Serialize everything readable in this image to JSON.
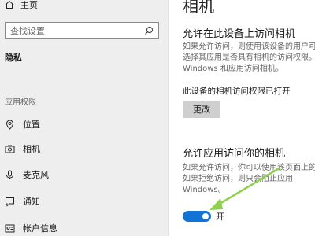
{
  "sidebar": {
    "home_label": "主页",
    "search_placeholder": "查找设置",
    "privacy_label": "隐私",
    "section_label": "应用权限",
    "items": [
      {
        "label": "位置",
        "icon": "location-icon"
      },
      {
        "label": "相机",
        "icon": "camera-icon"
      },
      {
        "label": "麦克风",
        "icon": "microphone-icon"
      },
      {
        "label": "通知",
        "icon": "notification-icon"
      },
      {
        "label": "帐户信息",
        "icon": "account-info-icon"
      }
    ]
  },
  "main": {
    "title": "相机",
    "device_access": {
      "heading": "允许在此设备上访问相机",
      "description_lines": [
        "如果允许访问，则使用该设备的用户可",
        "选择其应用是否具有相机的访问权限。",
        "Windows 和应用访问相机。"
      ],
      "status": "此设备的相机访问权限已打开",
      "change_button": "更改"
    },
    "app_access": {
      "heading": "允许应用访问你的相机",
      "description_lines": [
        "如果允许访问，你可以使用该页面上的",
        "如果拒绝访问，则只会阻止应用",
        "Windows。"
      ],
      "toggle_label": "开",
      "toggle_on": true
    }
  },
  "colors": {
    "accent": "#1272d6",
    "arrow": "#8fd14f"
  }
}
